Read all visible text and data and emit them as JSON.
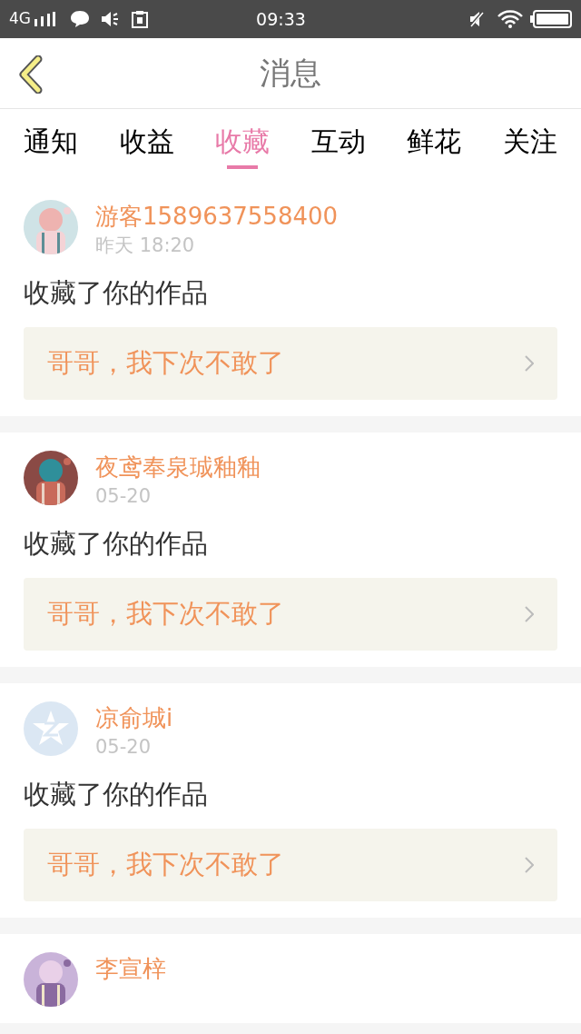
{
  "status_bar": {
    "network": "4G",
    "time": "09:33"
  },
  "header": {
    "title": "消息"
  },
  "tabs": [
    {
      "label": "通知",
      "selected": false
    },
    {
      "label": "收益",
      "selected": false
    },
    {
      "label": "收藏",
      "selected": true
    },
    {
      "label": "互动",
      "selected": false
    },
    {
      "label": "鲜花",
      "selected": false
    },
    {
      "label": "关注",
      "selected": false
    }
  ],
  "messages": [
    {
      "name": "游客1589637558400",
      "time": "昨天 18:20",
      "action": "收藏了你的作品",
      "work": "哥哥，我下次不敢了"
    },
    {
      "name": "夜鸢奉泉珹釉釉",
      "time": "05-20",
      "action": "收藏了你的作品",
      "work": "哥哥，我下次不敢了"
    },
    {
      "avatar": {
        "kind": "default"
      },
      "name": "凉俞城i",
      "time": "05-20",
      "action": "收藏了你的作品",
      "work": "哥哥，我下次不敢了"
    },
    {
      "name": "李宣梓"
    }
  ]
}
